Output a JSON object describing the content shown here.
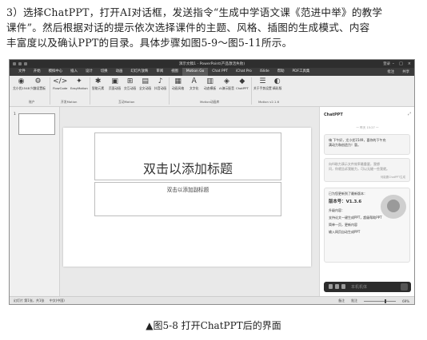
{
  "paragraph": {
    "line1": "3）选择ChatPPT，打开AI对话框，发送指令“生成中学语文课《范进中举》的教学",
    "line2": "课件”。然后根据对话的提示依次选择课件的主题、风格、插图的生成模式、内容",
    "line3": "丰富度以及确认PPT的目录。具体步骤如图5-9～图5-11所示。"
  },
  "screenshot": {
    "window_title": "演示文稿1 - PowerPoint(产品激活失败)",
    "user": "登录",
    "menu_tabs": [
      "文件",
      "开始",
      "模拟中心",
      "插入",
      "设计",
      "切换",
      "动画",
      "幻灯片放映",
      "审阅",
      "视图",
      "Motion Go",
      "Chat PPT",
      "iChat Pro",
      "iSlide",
      "帮助",
      "PDF工具集"
    ],
    "active_tab": "Motion Go",
    "menu_right": [
      "批注",
      "共享"
    ],
    "ribbon": {
      "buttons": [
        {
          "label": "尤小优1548",
          "icon": "avatar-icon"
        },
        {
          "label": "兴趣设置板",
          "icon": "settings-icon"
        },
        {
          "label": "FlowCode",
          "icon": "code-icon"
        },
        {
          "label": "EasyMotion",
          "icon": "motion-icon"
        },
        {
          "label": "智能元素",
          "icon": "element-icon"
        },
        {
          "label": "页面动画",
          "icon": "page-icon"
        },
        {
          "label": "交互动画",
          "icon": "interact-icon"
        },
        {
          "label": "全文动画",
          "icon": "doc-anim-icon"
        },
        {
          "label": "抖音动画",
          "icon": "tiktok-icon"
        },
        {
          "label": "动画风格",
          "icon": "style-icon"
        },
        {
          "label": "文字化",
          "icon": "text-icon"
        },
        {
          "label": "动态模板",
          "icon": "template-icon"
        },
        {
          "label": "AI演示配音",
          "icon": "voice-icon"
        },
        {
          "label": "ChatPPT",
          "icon": "chatppt-icon"
        },
        {
          "label": "关于手势设置",
          "icon": "gesture-icon"
        },
        {
          "label": "精彩版",
          "icon": "toggle-icon"
        }
      ],
      "groups": [
        "账户",
        "开发Motion",
        "互动Motion",
        "Motion动画库",
        "Motion v2.1.6"
      ]
    },
    "slide_number": "1",
    "slide_title_placeholder": "双击以添加标题",
    "slide_subtitle_placeholder": "双击以添加副标题",
    "chat_panel": {
      "title": "ChatPPT",
      "timestamp": "一 昨天 15:27 一",
      "greeting_line1": "嗨 下午好，尤小优1549，喜你的下午充",
      "greeting_line2": "满动力和创造力！冒。",
      "hint_line1": "向AI助力演示文件效率最重要，我想",
      "hint_line2": "问，你就告诉我能力，可以无缝一些我就。",
      "hint_note": "何能要ChatPPT生成",
      "update_title": "已为您更新到了最新版本：",
      "version": "版本号：V1.3.6",
      "update_heading": "升级内容：",
      "update_items": [
        "支持论文一键生成PPT，超级帮助PPT",
        "简单一页，更新内容",
        "输入网页自动生成PPT"
      ],
      "input_placeholder": "本机机体"
    },
    "status_left": "幻灯片 第1张，共1张",
    "status_lang": "中文(中国)",
    "status_right": [
      "备注",
      "批注"
    ],
    "zoom": "69%"
  },
  "caption": "▲图5-8  打开ChatPPT后的界面"
}
